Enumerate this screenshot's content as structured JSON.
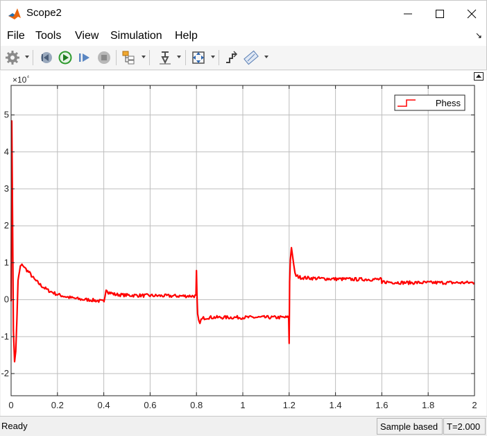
{
  "window": {
    "title": "Scope2"
  },
  "menu": [
    "File",
    "Tools",
    "View",
    "Simulation",
    "Help"
  ],
  "toolbar": {
    "icons": [
      "settings-icon",
      "step-back-icon",
      "run-icon",
      "step-forward-icon",
      "stop-icon",
      "signal-hierarchy-icon",
      "highlight-block-icon",
      "zoom-fit-icon",
      "scale-axes-icon",
      "measurements-icon"
    ]
  },
  "status": {
    "ready": "Ready",
    "mode": "Sample based",
    "time": "T=2.000"
  },
  "colors": {
    "signal": "#ff0000",
    "grid": "#bdbdbd",
    "axes": "#262626"
  },
  "chart_data": {
    "type": "line",
    "xlim": [
      0,
      2
    ],
    "ylim": [
      -2.6,
      5.8
    ],
    "y_multiplier": "×10⁴",
    "x_ticks": [
      0,
      0.2,
      0.4,
      0.6,
      0.8,
      1,
      1.2,
      1.4,
      1.6,
      1.8,
      2
    ],
    "x_tick_labels": [
      "0",
      "0.2",
      "0.4",
      "0.6",
      "0.8",
      "1",
      "1.2",
      "1.4",
      "1.6",
      "1.8",
      "2"
    ],
    "y_ticks": [
      -2,
      -1,
      0,
      1,
      2,
      3,
      4,
      5
    ],
    "y_tick_labels": [
      "-2",
      "-1",
      "0",
      "1",
      "2",
      "3",
      "4",
      "5"
    ],
    "grid": true,
    "legend": {
      "position": "top-right",
      "entries": [
        "Phess"
      ]
    },
    "series": [
      {
        "name": "Phess",
        "x": [
          0,
          0.003,
          0.006,
          0.01,
          0.015,
          0.02,
          0.025,
          0.03,
          0.04,
          0.05,
          0.06,
          0.08,
          0.1,
          0.13,
          0.16,
          0.2,
          0.25,
          0.3,
          0.35,
          0.398,
          0.401,
          0.405,
          0.41,
          0.42,
          0.45,
          0.5,
          0.6,
          0.7,
          0.798,
          0.8,
          0.802,
          0.805,
          0.81,
          0.815,
          0.82,
          0.83,
          0.85,
          0.9,
          1.0,
          1.1,
          1.198,
          1.2,
          1.201,
          1.202,
          1.205,
          1.21,
          1.215,
          1.22,
          1.225,
          1.23,
          1.24,
          1.25,
          1.3,
          1.4,
          1.5,
          1.598,
          1.6,
          1.602,
          1.606,
          1.61,
          1.65,
          1.7,
          1.8,
          1.9,
          2.0
        ],
        "y": [
          0,
          4.8,
          2.5,
          -0.8,
          -1.7,
          -1.4,
          -0.5,
          0.5,
          0.9,
          0.95,
          0.85,
          0.72,
          0.55,
          0.38,
          0.25,
          0.14,
          0.06,
          0.01,
          -0.01,
          -0.05,
          -0.08,
          0.1,
          0.3,
          0.2,
          0.14,
          0.12,
          0.11,
          0.1,
          0.1,
          0.75,
          0.1,
          -0.4,
          -0.6,
          -0.6,
          -0.55,
          -0.5,
          -0.48,
          -0.48,
          -0.48,
          -0.48,
          -0.48,
          -1.2,
          -0.5,
          0.5,
          1.1,
          1.4,
          1.2,
          0.9,
          0.7,
          0.65,
          0.62,
          0.6,
          0.58,
          0.56,
          0.55,
          0.55,
          0.4,
          0.45,
          0.5,
          0.48,
          0.47,
          0.46,
          0.46,
          0.46,
          0.46
        ]
      }
    ]
  }
}
